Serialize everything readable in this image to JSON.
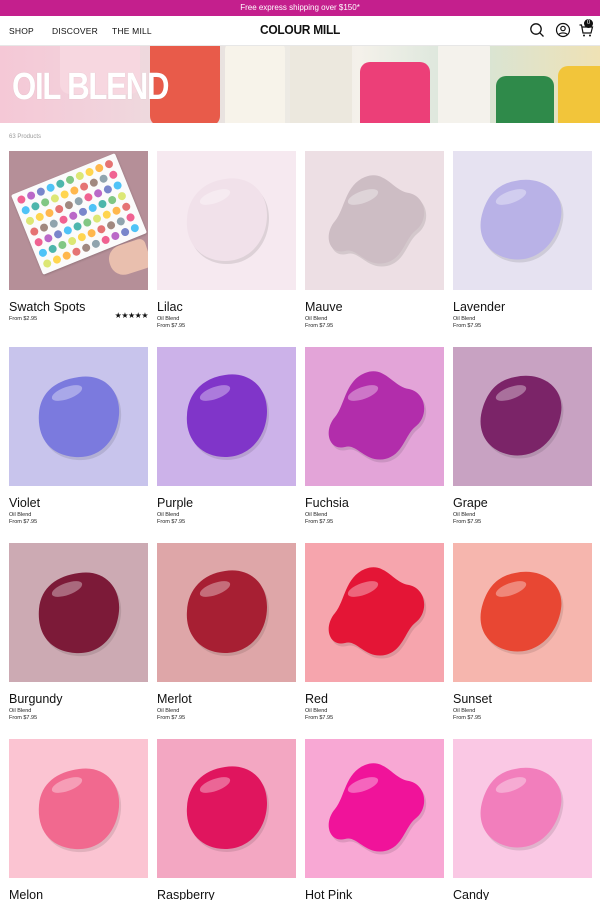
{
  "promo": {
    "text": "Free express shipping over $150*"
  },
  "nav": {
    "links": [
      "SHOP",
      "DISCOVER",
      "THE MILL"
    ],
    "logo": "COLOUR MILL",
    "cart_count": "0"
  },
  "hero": {
    "title": "OIL BLEND"
  },
  "listing": {
    "count_text": "63 Products"
  },
  "products": [
    {
      "name": "Swatch Spots",
      "subtitle": "",
      "price": "From $2.95",
      "rating": "★★★★★",
      "image": "swatch-sheet",
      "bg": "#b58f98",
      "blob": ""
    },
    {
      "name": "Lilac",
      "subtitle": "Oil Blend",
      "price": "From $7.95",
      "image": "blob",
      "bg": "#f6e9f0",
      "blob": "#f1e1ea"
    },
    {
      "name": "Mauve",
      "subtitle": "Oil Blend",
      "price": "From $7.95",
      "image": "blob",
      "bg": "#eddfe4",
      "blob": "#cdbdc4"
    },
    {
      "name": "Lavender",
      "subtitle": "Oil Blend",
      "price": "From $7.95",
      "image": "blob",
      "bg": "#e6e2f1",
      "blob": "#b9b2e7"
    },
    {
      "name": "Violet",
      "subtitle": "Oil Blend",
      "price": "From $7.95",
      "image": "blob",
      "bg": "#c8c4ec",
      "blob": "#7b7ade"
    },
    {
      "name": "Purple",
      "subtitle": "Oil Blend",
      "price": "From $7.95",
      "image": "blob",
      "bg": "#ccb2e9",
      "blob": "#8035c9"
    },
    {
      "name": "Fuchsia",
      "subtitle": "Oil Blend",
      "price": "From $7.95",
      "image": "blob",
      "bg": "#e3a4d8",
      "blob": "#b22dab"
    },
    {
      "name": "Grape",
      "subtitle": "Oil Blend",
      "price": "From $7.95",
      "image": "blob",
      "bg": "#c8a2c2",
      "blob": "#7b2468"
    },
    {
      "name": "Burgundy",
      "subtitle": "Oil Blend",
      "price": "From $7.95",
      "image": "blob",
      "bg": "#ccaab3",
      "blob": "#7c1a38"
    },
    {
      "name": "Merlot",
      "subtitle": "Oil Blend",
      "price": "From $7.95",
      "image": "blob",
      "bg": "#dea6a8",
      "blob": "#a71f33"
    },
    {
      "name": "Red",
      "subtitle": "Oil Blend",
      "price": "From $7.95",
      "image": "blob",
      "bg": "#f6a5ad",
      "blob": "#e41536"
    },
    {
      "name": "Sunset",
      "subtitle": "Oil Blend",
      "price": "From $7.95",
      "image": "blob",
      "bg": "#f6b6ae",
      "blob": "#e84733"
    },
    {
      "name": "Melon",
      "subtitle": "",
      "price": "",
      "image": "blob",
      "bg": "#fbc4d2",
      "blob": "#f1698f"
    },
    {
      "name": "Raspberry",
      "subtitle": "",
      "price": "",
      "image": "blob",
      "bg": "#f3a7c2",
      "blob": "#e0155e"
    },
    {
      "name": "Hot Pink",
      "subtitle": "",
      "price": "",
      "image": "blob",
      "bg": "#f8a8d4",
      "blob": "#f0139a"
    },
    {
      "name": "Candy",
      "subtitle": "",
      "price": "",
      "image": "blob",
      "bg": "#fac8e4",
      "blob": "#f27ebc"
    }
  ]
}
